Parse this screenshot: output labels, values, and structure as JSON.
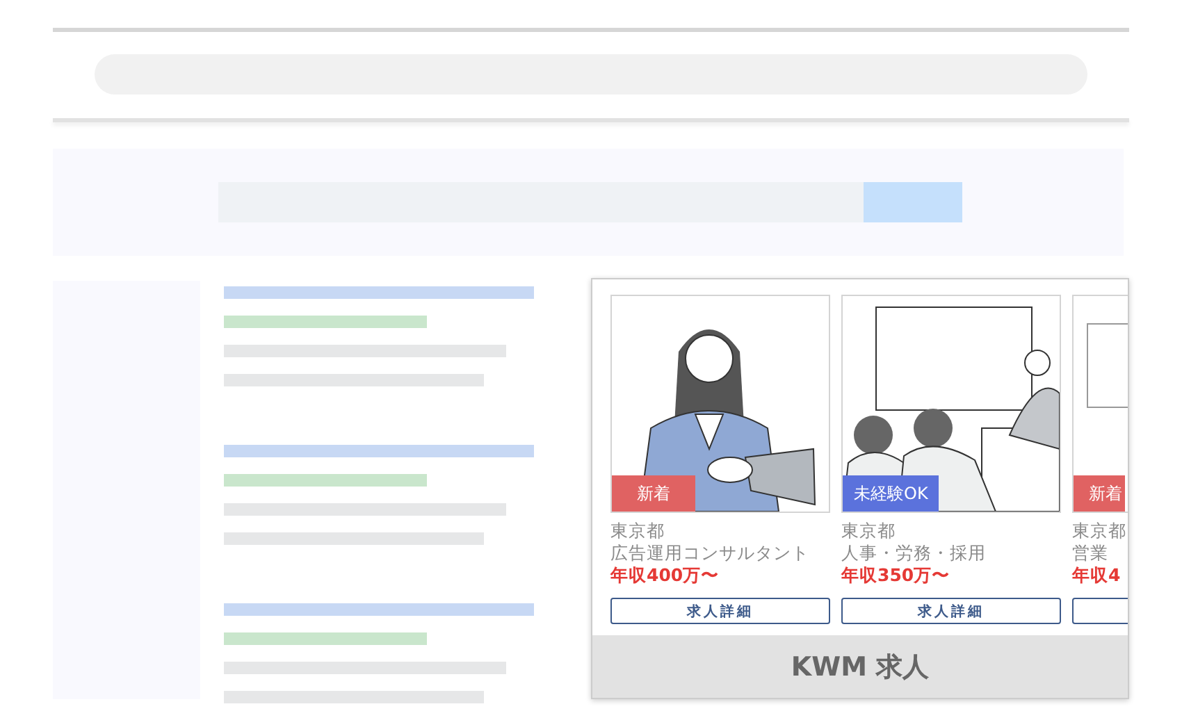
{
  "widget": {
    "brand": "KWM 求人",
    "jobs": [
      {
        "badge": {
          "label": "新着",
          "kind": "new"
        },
        "location": "東京都",
        "title": "広告運用コンサルタント",
        "salary": "年収400万〜",
        "button": "求人詳細"
      },
      {
        "badge": {
          "label": "未経験OK",
          "kind": "beginner"
        },
        "location": "東京都",
        "title": "人事・労務・採用",
        "salary": "年収350万〜",
        "button": "求人詳細"
      },
      {
        "badge": {
          "label": "新着",
          "kind": "new"
        },
        "location": "東京都",
        "title": "営業",
        "salary": "年収4"
      }
    ]
  }
}
